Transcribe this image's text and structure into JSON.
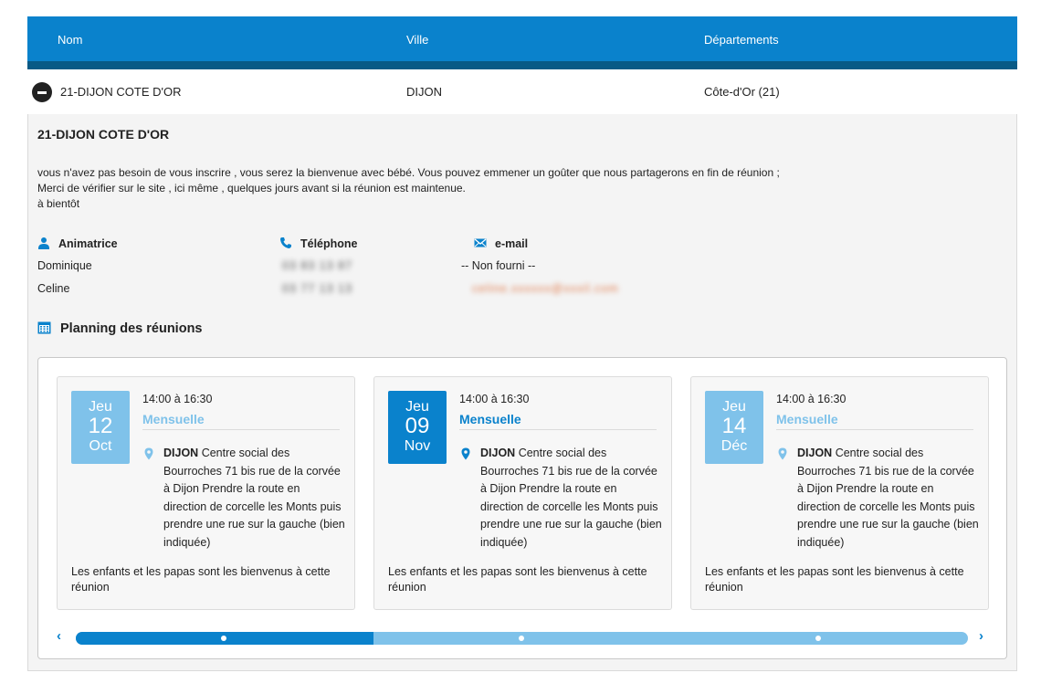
{
  "table": {
    "headers": [
      "Nom",
      "Ville",
      "Départements"
    ],
    "row": {
      "nom": "21-DIJON COTE D'OR",
      "ville": "DIJON",
      "departement": "Côte-d'Or (21)"
    }
  },
  "detail": {
    "title": "21-DIJON COTE D'OR",
    "description": [
      "vous n'avez pas besoin de vous inscrire , vous serez la bienvenue avec bébé. Vous pouvez emmener un goûter que nous partagerons en fin de réunion ;",
      "Merci de vérifier sur le site , ici même , quelques jours avant si la réunion est maintenue.",
      "à bientôt"
    ],
    "columns": {
      "animatrice": "Animatrice",
      "telephone": "Téléphone",
      "email": "e-mail"
    },
    "contacts": [
      {
        "name": "Dominique",
        "phone": "03 83 13 87",
        "email": "-- Non fourni --"
      },
      {
        "name": "Celine",
        "phone": "03 77 13 13",
        "email": "celine.xxxxxx@xxxil.com"
      }
    ],
    "planning_title": "Planning des réunions",
    "meetings": [
      {
        "day": "Jeu",
        "date": "12",
        "month": "Oct",
        "time": "14:00 à 16:30",
        "frequency": "Mensuelle",
        "city": "DIJON",
        "address": "Centre social des Bourroches 71 bis rue de la corvée à Dijon Prendre la route en direction de corcelle les Monts puis prendre une rue sur la gauche (bien indiquée)",
        "note": "Les enfants et les papas sont les bienvenus à cette réunion",
        "active": false
      },
      {
        "day": "Jeu",
        "date": "09",
        "month": "Nov",
        "time": "14:00 à 16:30",
        "frequency": "Mensuelle",
        "city": "DIJON",
        "address": "Centre social des Bourroches 71 bis rue de la corvée à Dijon Prendre la route en direction de corcelle les Monts puis prendre une rue sur la gauche (bien indiquée)",
        "note": "Les enfants et les papas sont les bienvenus à cette réunion",
        "active": true
      },
      {
        "day": "Jeu",
        "date": "14",
        "month": "Déc",
        "time": "14:00 à 16:30",
        "frequency": "Mensuelle",
        "city": "DIJON",
        "address": "Centre social des Bourroches 71 bis rue de la corvée à Dijon Prendre la route en direction de corcelle les Monts puis prendre une rue sur la gauche (bien indiquée)",
        "note": "Les enfants et les papas sont les bienvenus à cette réunion",
        "active": false
      }
    ],
    "carousel": {
      "pages": 3,
      "active_page": 1,
      "prev": "‹",
      "next": "›"
    }
  },
  "colors": {
    "primary": "#0a82cc",
    "primary_dark": "#085a86",
    "light_blue": "#7fc2ea",
    "panel_bg": "#f4f4f4"
  },
  "icons": {
    "row_toggle": "minus-circle-icon",
    "animatrice": "person-icon",
    "telephone": "phone-icon",
    "email": "envelope-icon",
    "planning": "calendar-icon",
    "location": "map-pin-icon"
  }
}
